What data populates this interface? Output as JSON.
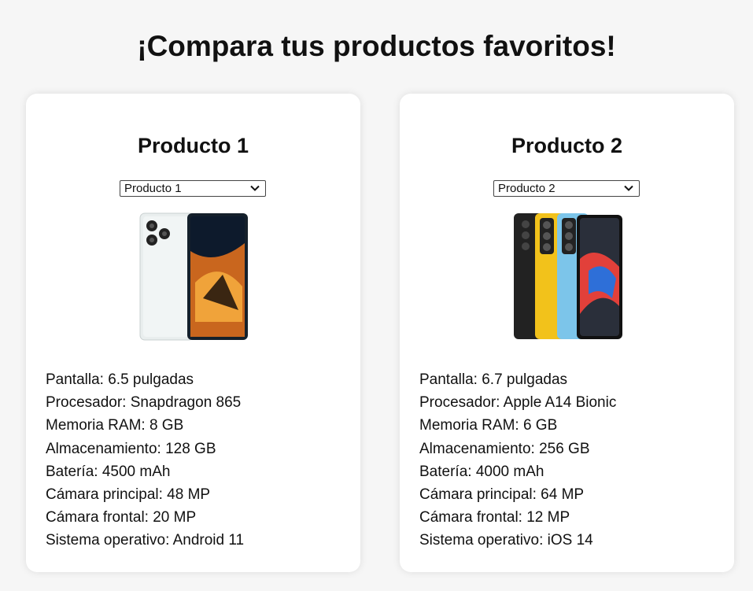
{
  "page": {
    "title": "¡Compara tus productos favoritos!"
  },
  "products": [
    {
      "heading": "Producto 1",
      "selected": "Producto 1",
      "specs": [
        "Pantalla: 6.5 pulgadas",
        "Procesador: Snapdragon 865",
        "Memoria RAM: 8 GB",
        "Almacenamiento: 128 GB",
        "Batería: 4500 mAh",
        "Cámara principal: 48 MP",
        "Cámara frontal: 20 MP",
        "Sistema operativo: Android 11"
      ]
    },
    {
      "heading": "Producto 2",
      "selected": "Producto 2",
      "specs": [
        "Pantalla: 6.7 pulgadas",
        "Procesador: Apple A14 Bionic",
        "Memoria RAM: 6 GB",
        "Almacenamiento: 256 GB",
        "Batería: 4000 mAh",
        "Cámara principal: 64 MP",
        "Cámara frontal: 12 MP",
        "Sistema operativo: iOS 14"
      ]
    }
  ],
  "colors": {
    "card_bg": "#ffffff",
    "page_bg": "#f6f6f6",
    "phone2_yellow": "#f2c21b",
    "phone2_blue": "#7cc5ea"
  }
}
